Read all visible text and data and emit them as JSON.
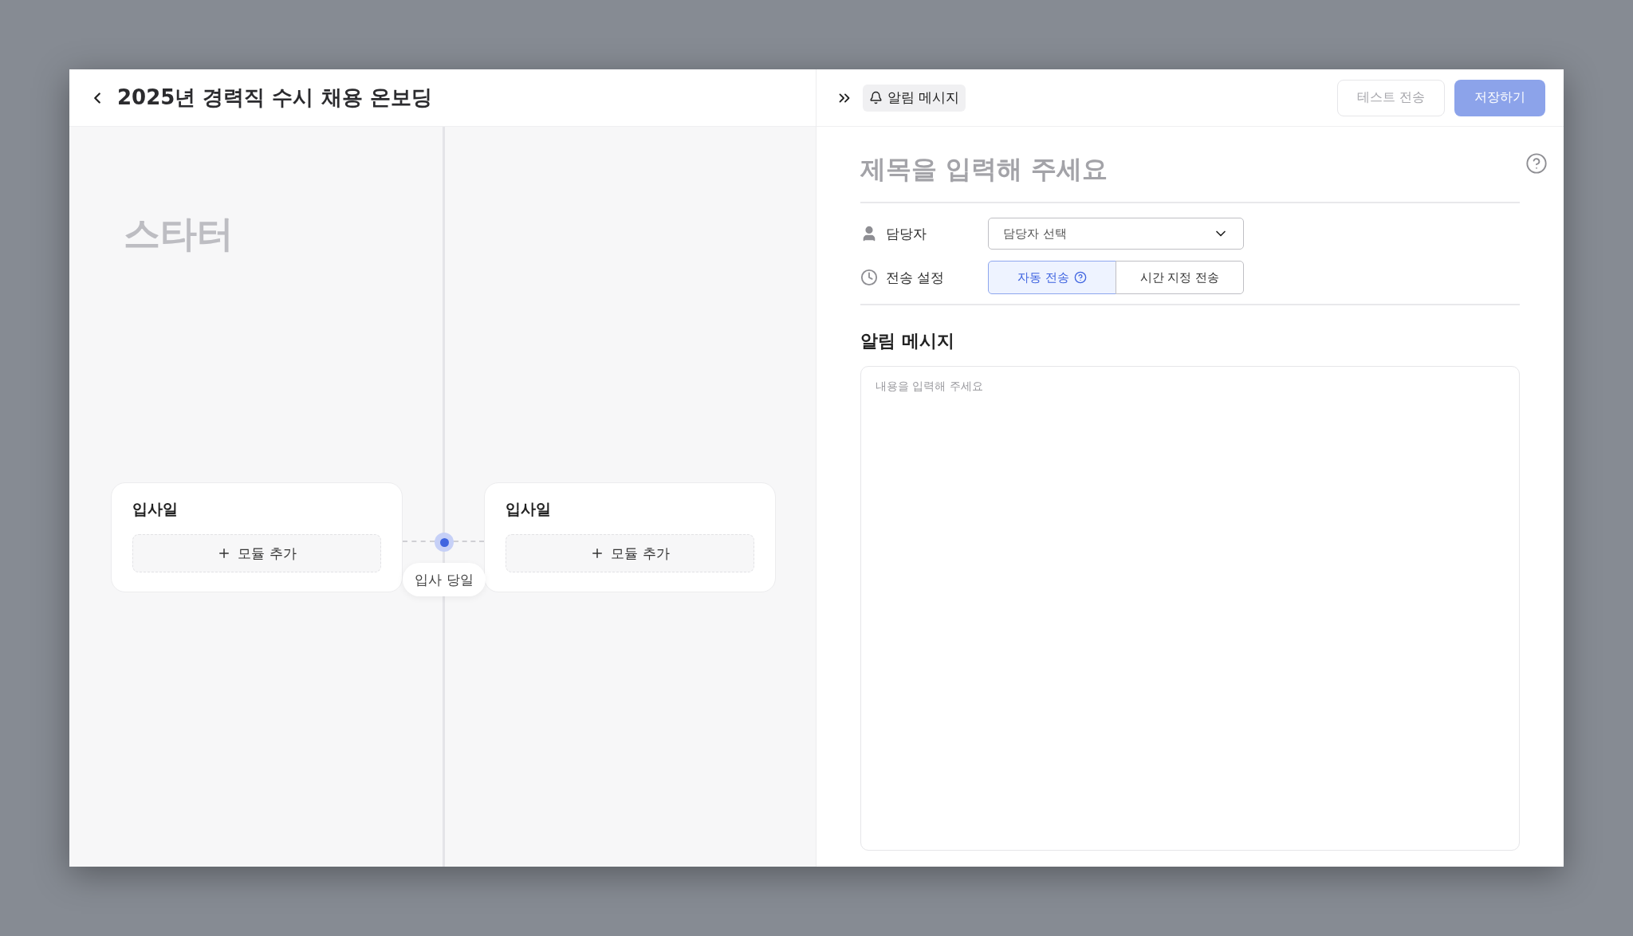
{
  "header": {
    "title": "2025년 경력직 수시 채용 온보딩"
  },
  "canvas": {
    "stage_title": "스타터",
    "columns": [
      {
        "title": "입사일",
        "add_label": "모듈 추가"
      },
      {
        "title": "입사일",
        "add_label": "모듈 추가"
      }
    ],
    "marker": {
      "label": "입사 당일"
    }
  },
  "panel": {
    "tab": "알림 메시지",
    "buttons": [
      {
        "label": "테스트 전송",
        "kind": "secondary",
        "disabled": true
      },
      {
        "label": "저장하기",
        "kind": "primary",
        "disabled": true
      }
    ],
    "title_placeholder": "제목을 입력해 주세요",
    "fields": [
      {
        "kind": "select",
        "label": "담당자",
        "placeholder": "담당자 선택"
      },
      {
        "kind": "segmented",
        "label": "전송 설정",
        "options": [
          {
            "label": "자동 전송",
            "selected": true,
            "help": true
          },
          {
            "label": "시간 지정 전송",
            "selected": false,
            "help": false
          }
        ]
      }
    ],
    "message": {
      "heading": "알림 메시지",
      "placeholder": "내용을 입력해 주세요"
    }
  }
}
